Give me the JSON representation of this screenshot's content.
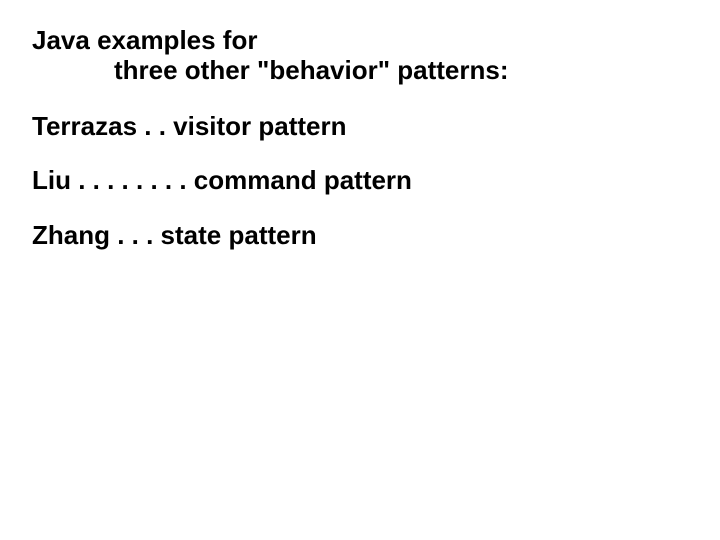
{
  "heading": {
    "line1": "Java examples for",
    "line2": "three other \"behavior\" patterns:"
  },
  "entries": [
    "Terrazas . . visitor pattern",
    "Liu  . . . . . . . . command pattern",
    "Zhang  . . . state pattern"
  ]
}
